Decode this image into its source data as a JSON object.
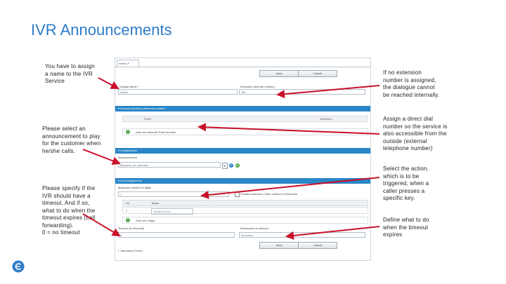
{
  "slide": {
    "title": "IVR Announcements"
  },
  "notes": {
    "assign_name": "You have to assign\na name to the IVR\nService",
    "select_announcement": "Please select an\nannouncement to play\nfor the customer when\nhe/she calls.",
    "timeout": "Please specify if the\nIVR should have a\ntimeout. And if so,\nwhat to do when the\ntimeout expires (call\nforwarding).\n0 = no timeout",
    "extension": "If no extension\nnumber is assigned,\nthe dialogue cannot\nbe reached internally.",
    "direct_dial": "Assign a direct dial\nnumber so the service is\nalso accessible from the\noutside (external\ntelephone number)",
    "select_action": "Select the action,\nwhich is to be\ntriggered, when a\ncaller presses a\nspecific key.",
    "define_timeout": "Define what to do\nwhen the timeout\nexpires"
  },
  "form": {
    "tab_label": "ivrtest ✕",
    "save_label": "Save",
    "cancel_label": "Cancel",
    "display_name_label": "Display Name *",
    "display_name_value": "ivrtest",
    "extension_label": "Extension (internal number)",
    "extension_value": "761",
    "inbound_section": "▾ Inbound numbers (external number)",
    "col_prefix": "Prefix",
    "col_extension": "Extension",
    "add_inbound_label": "Add new Inbound Trunk Number",
    "config_section": "▾ Configuration",
    "announcement_label": "Announcement",
    "announcement_value": "welcome_ivr_wav.wav",
    "keys_section": "▾ Key Assignments",
    "max_digits_label": "Maximum number of digits",
    "max_digits_value": "1",
    "forward_label": "Forward unknown Caller number to Extension",
    "col_no": "No",
    "col_target": "Target",
    "row_no": "1",
    "row_target": "Target not set",
    "add_target_label": "Add new Target",
    "timeout_label": "Timeout (in seconds)",
    "timeout_value": "0",
    "destination_label": "Destination on timeout",
    "destination_value": "No action",
    "mandatory_label": "*: Mandatory Fields"
  },
  "colors": {
    "accent": "#2e7bc9",
    "section_bar": "#2a86c8",
    "arrow": "#c9102a"
  }
}
